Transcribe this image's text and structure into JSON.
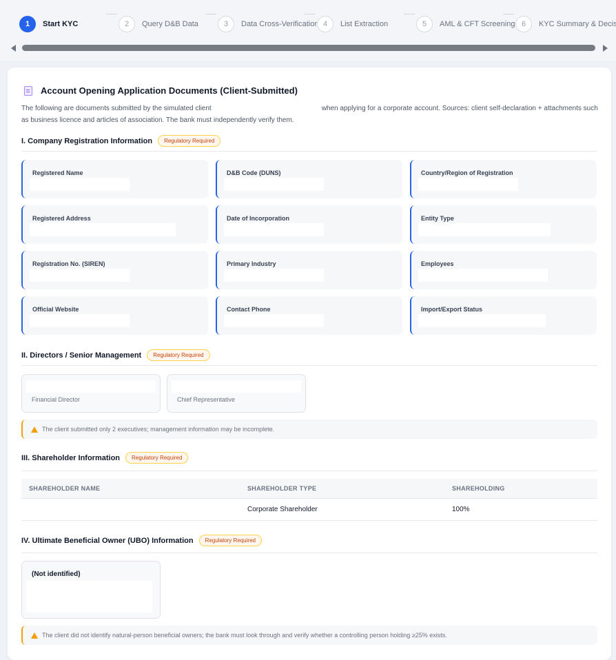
{
  "stepper": {
    "steps": [
      {
        "num": "1",
        "label": "Start KYC"
      },
      {
        "num": "2",
        "label": "Query D&B Data"
      },
      {
        "num": "3",
        "label": "Data Cross-Verification"
      },
      {
        "num": "4",
        "label": "List Extraction"
      },
      {
        "num": "5",
        "label": "AML & CFT Screening"
      },
      {
        "num": "6",
        "label": "KYC Summary & Decision"
      }
    ],
    "active_step": 1
  },
  "document": {
    "title": "Account Opening Application Documents (Client-Submitted)",
    "intro_part1": "The following are documents submitted by the simulated client",
    "intro_part2": "when applying for a corporate account. Sources: client self-declaration + attachments such as business licence and articles of association. The bank must independently verify them."
  },
  "badge_label": "Regulatory Required",
  "company": {
    "heading": "I. Company Registration Information",
    "fields": [
      {
        "label": "Registered Name"
      },
      {
        "label": "D&B Code (DUNS)"
      },
      {
        "label": "Country/Region of Registration"
      },
      {
        "label": "Registered Address"
      },
      {
        "label": "Date of Incorporation"
      },
      {
        "label": "Entity Type"
      },
      {
        "label": "Registration No. (SIREN)"
      },
      {
        "label": "Primary Industry"
      },
      {
        "label": "Employees"
      },
      {
        "label": "Official Website"
      },
      {
        "label": "Contact Phone"
      },
      {
        "label": "Import/Export Status"
      }
    ]
  },
  "directors": {
    "heading": "II. Directors / Senior Management",
    "people": [
      {
        "role": "Financial Director"
      },
      {
        "role": "Chief Representative"
      }
    ],
    "alert": "The client submitted only 2 executives; management information may be incomplete."
  },
  "shareholders": {
    "heading": "III. Shareholder Information",
    "columns": [
      "SHAREHOLDER NAME",
      "SHAREHOLDER TYPE",
      "SHAREHOLDING"
    ],
    "rows": [
      [
        "",
        "Corporate Shareholder",
        "100%"
      ]
    ]
  },
  "ubo": {
    "heading": "IV. Ultimate Beneficial Owner (UBO) Information",
    "name": "(Not identified)",
    "alert": "The client did not identify natural-person beneficial owners; the bank must look through and verify whether a controlling person holding ≥25% exists."
  },
  "colors": {
    "accent": "#2563eb",
    "warning": "#f59e0b",
    "badge_text": "#c2410c"
  },
  "icons": [
    "document-icon",
    "warning-icon",
    "scroll-left-arrow-icon",
    "scroll-right-arrow-icon"
  ]
}
